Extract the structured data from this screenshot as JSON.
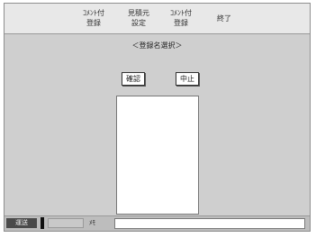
{
  "menu": {
    "items": [
      {
        "label": "ｺﾒﾝﾄ付\n登録"
      },
      {
        "label": "見積元\n設定"
      },
      {
        "label": "ｺﾒﾝﾄ付\n登録"
      },
      {
        "label": "終了"
      }
    ]
  },
  "dialog": {
    "title": "＜登録名選択＞",
    "ok_label": "確認",
    "cancel_label": "中止"
  },
  "list": {
    "items": []
  },
  "status_bar": {
    "mode_label": "運送",
    "input_label": "ﾒﾓ",
    "input_value": ""
  }
}
